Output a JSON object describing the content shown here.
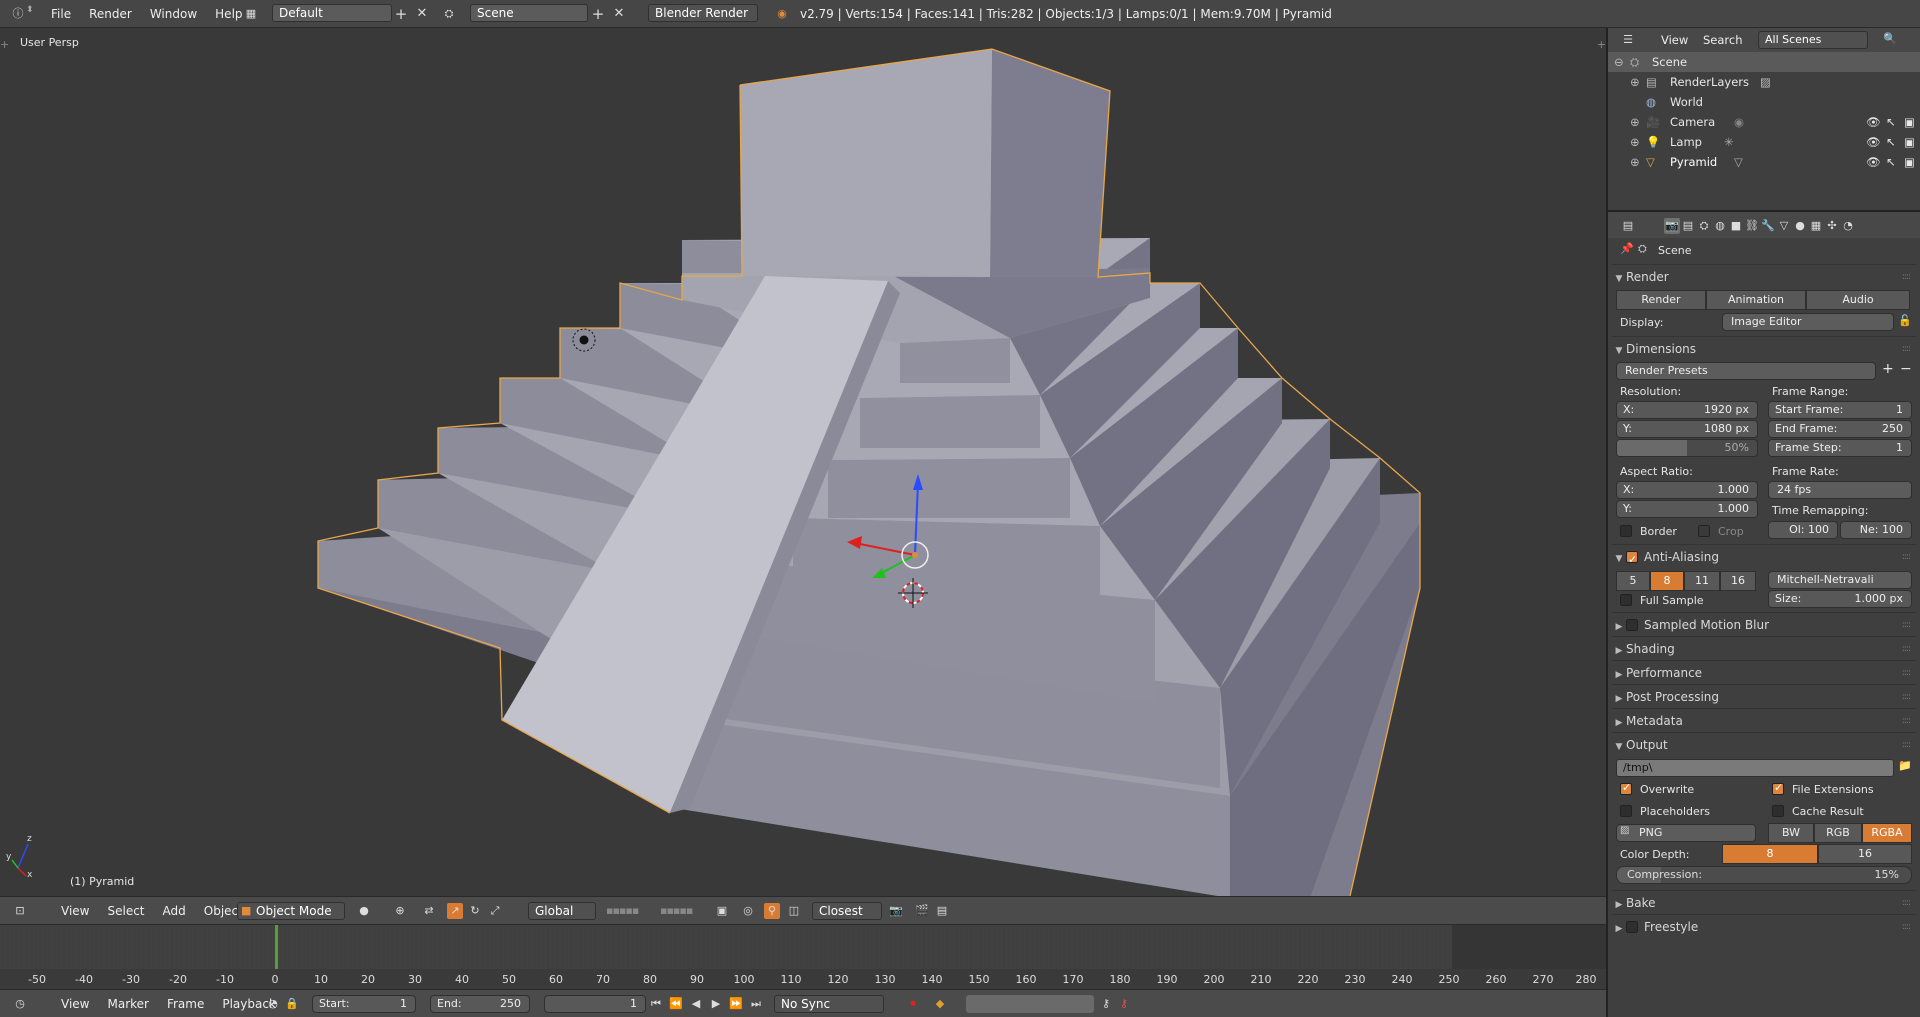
{
  "topbar": {
    "info_icon": "info-icon",
    "menus": [
      "File",
      "Render",
      "Window",
      "Help"
    ],
    "layout_value": "Default",
    "scene_value": "Scene",
    "engine_value": "Blender Render",
    "stats": "v2.79 | Verts:154 | Faces:141 | Tris:282 | Objects:1/3 | Lamps:0/1 | Mem:9.70M | Pyramid"
  },
  "viewport": {
    "view_label": "User Persp",
    "object_label": "(1) Pyramid",
    "axis_z": "z",
    "axis_y": "y",
    "axis_x": "x"
  },
  "view_header": {
    "menus": [
      "View",
      "Select",
      "Add",
      "Object"
    ],
    "mode_value": "Object Mode",
    "orientation_value": "Global",
    "snap_value": "Closest"
  },
  "timeline": {
    "ticks": [
      "-50",
      "-40",
      "-30",
      "-20",
      "-10",
      "0",
      "10",
      "20",
      "30",
      "40",
      "50",
      "60",
      "70",
      "80",
      "90",
      "100",
      "110",
      "120",
      "130",
      "140",
      "150",
      "160",
      "170",
      "180",
      "190",
      "200",
      "210",
      "220",
      "230",
      "240",
      "250",
      "260",
      "270",
      "280"
    ],
    "current_frame": 0
  },
  "time_header": {
    "menus": [
      "View",
      "Marker",
      "Frame",
      "Playback"
    ],
    "start_label": "Start:",
    "start_value": "1",
    "end_label": "End:",
    "end_value": "250",
    "current_value": "1",
    "sync_value": "No Sync"
  },
  "outliner": {
    "menus": [
      "View",
      "Search"
    ],
    "scenes_value": "All Scenes",
    "items": [
      {
        "label": "Scene",
        "level": 0
      },
      {
        "label": "RenderLayers",
        "level": 1
      },
      {
        "label": "World",
        "level": 1
      },
      {
        "label": "Camera",
        "level": 1
      },
      {
        "label": "Lamp",
        "level": 1
      },
      {
        "label": "Pyramid",
        "level": 1
      }
    ]
  },
  "properties": {
    "context": "Scene",
    "render": {
      "title": "Render",
      "render_btn": "Render",
      "animation_btn": "Animation",
      "audio_btn": "Audio",
      "display_label": "Display:",
      "display_value": "Image Editor"
    },
    "dimensions": {
      "title": "Dimensions",
      "presets": "Render Presets",
      "resolution_label": "Resolution:",
      "res_x_label": "X:",
      "res_x": "1920 px",
      "res_y_label": "Y:",
      "res_y": "1080 px",
      "res_pct": "50%",
      "res_pct_value": 0.5,
      "frame_range_label": "Frame Range:",
      "start_frame_label": "Start Frame:",
      "start_frame": "1",
      "end_frame_label": "End Frame:",
      "end_frame": "250",
      "frame_step_label": "Frame Step:",
      "frame_step": "1",
      "aspect_label": "Aspect Ratio:",
      "asp_x_label": "X:",
      "asp_x": "1.000",
      "asp_y_label": "Y:",
      "asp_y": "1.000",
      "frame_rate_label": "Frame Rate:",
      "frame_rate": "24 fps",
      "time_remap_label": "Time Remapping:",
      "old": "Ol: 100",
      "new": "Ne: 100",
      "border": "Border",
      "crop": "Crop"
    },
    "aa": {
      "title": "Anti-Aliasing",
      "samples": [
        "5",
        "8",
        "11",
        "16"
      ],
      "active_sample": "8",
      "filter": "Mitchell-Netravali",
      "full_sample": "Full Sample",
      "size_label": "Size:",
      "size_value": "1.000 px"
    },
    "collapsed_panels": [
      "Sampled Motion Blur",
      "Shading",
      "Performance",
      "Post Processing",
      "Metadata"
    ],
    "output": {
      "title": "Output",
      "path": "/tmp\\",
      "overwrite": "Overwrite",
      "file_extensions": "File Extensions",
      "placeholders": "Placeholders",
      "cache_result": "Cache Result",
      "format": "PNG",
      "color_modes": [
        "BW",
        "RGB",
        "RGBA"
      ],
      "active_color_mode": "RGBA",
      "depth_label": "Color Depth:",
      "depths": [
        "8",
        "16"
      ],
      "active_depth": "8",
      "compression": "Compression:",
      "compression_value": "15%",
      "compression_fraction": 0.15
    },
    "bottom_panels": [
      "Bake",
      "Freestyle"
    ]
  },
  "colors": {
    "accent": "#e0863a",
    "mesh": "#9a9aa8",
    "select_outline": "#e8a64a"
  }
}
